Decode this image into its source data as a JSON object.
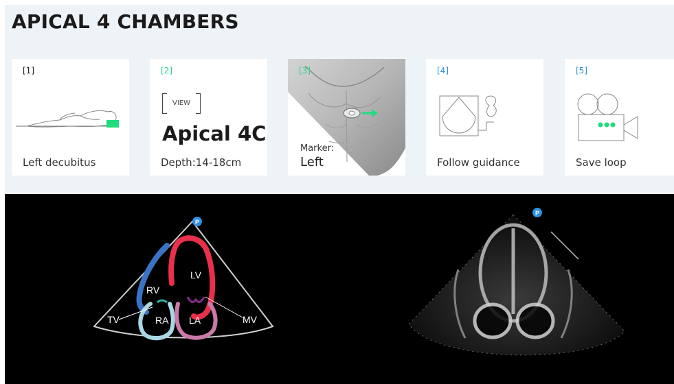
{
  "page_title": "APICAL 4 CHAMBERS",
  "cards": [
    {
      "step": "[1]",
      "caption": "Left decubitus"
    },
    {
      "step": "[2]",
      "view_box": "VIEW",
      "view_name": "Apical 4C",
      "caption": "Depth:14-18cm"
    },
    {
      "step": "[3]",
      "marker_label": "Marker:",
      "marker_value": "Left"
    },
    {
      "step": "[4]",
      "caption": "Follow guidance"
    },
    {
      "step": "[5]",
      "caption": "Save loop"
    }
  ],
  "diagram": {
    "badge": "P",
    "labels": {
      "lv": "LV",
      "rv": "RV",
      "ra": "RA",
      "la": "LA",
      "tv": "TV",
      "mv": "MV"
    }
  },
  "echo": {
    "badge": "P"
  },
  "colors": {
    "step_black": "#1b1b1b",
    "step_green": "#2ad38b",
    "step_blue": "#2f8fe0",
    "lv": "#e8304a",
    "rv": "#3a73c4",
    "ra": "#a9d7e4",
    "la": "#c97aa8",
    "valve_teal": "#2fb5a8",
    "valve_purple": "#8a2a8c",
    "accent_green": "#1fdc7e",
    "badge_blue": "#2f8fe0"
  },
  "icons": [
    "patient-lying-icon",
    "chest-torso-image",
    "guidance-shapes-icon",
    "video-camera-icon"
  ]
}
